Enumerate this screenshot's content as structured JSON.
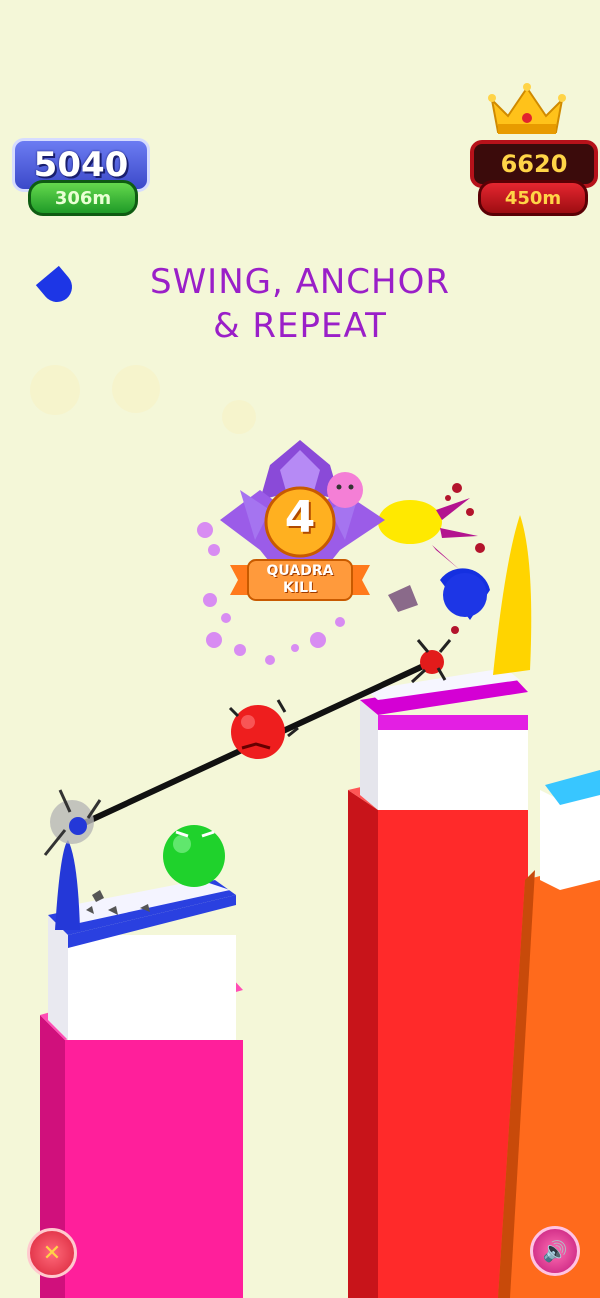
{
  "hud": {
    "player_score": "5040",
    "player_distance": "306m",
    "best_score": "6620",
    "best_distance": "450m"
  },
  "tagline": {
    "line1": "SWING, ANCHOR",
    "line2": "& REPEAT"
  },
  "kill_badge": {
    "count": "4",
    "label_line1": "QUADRA",
    "label_line2": "KILL"
  },
  "icons": {
    "close": "close-icon",
    "sound": "speaker-icon",
    "crown": "crown-icon"
  },
  "colors": {
    "background": "#f4f7d8",
    "tagline": "#9a1fc8",
    "pillar_pink": "#ff1f9b",
    "pillar_red": "#ff2a2a",
    "pillar_orange": "#ff6a1c"
  }
}
